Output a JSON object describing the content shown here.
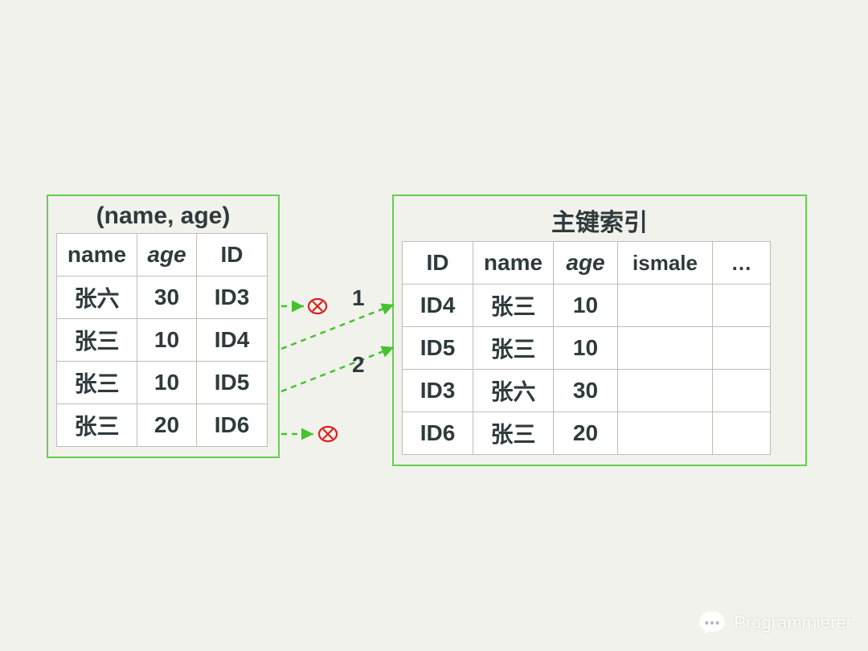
{
  "left": {
    "title": "(name, age)",
    "headers": [
      "name",
      "age",
      "ID"
    ],
    "rows": [
      {
        "name": "张六",
        "age": "30",
        "id": "ID3"
      },
      {
        "name": "张三",
        "age": "10",
        "id": "ID4"
      },
      {
        "name": "张三",
        "age": "10",
        "id": "ID5"
      },
      {
        "name": "张三",
        "age": "20",
        "id": "ID6"
      }
    ]
  },
  "right": {
    "title": "主键索引",
    "headers": [
      "ID",
      "name",
      "age",
      "ismale",
      "…"
    ],
    "rows": [
      {
        "id": "ID4",
        "name": "张三",
        "age": "10",
        "ismale": "",
        "etc": ""
      },
      {
        "id": "ID5",
        "name": "张三",
        "age": "10",
        "ismale": "",
        "etc": ""
      },
      {
        "id": "ID3",
        "name": "张六",
        "age": "30",
        "ismale": "",
        "etc": ""
      },
      {
        "id": "ID6",
        "name": "张三",
        "age": "20",
        "ismale": "",
        "etc": ""
      }
    ]
  },
  "arrows": {
    "label1": "1",
    "label2": "2"
  },
  "watermark": "Programmierer"
}
